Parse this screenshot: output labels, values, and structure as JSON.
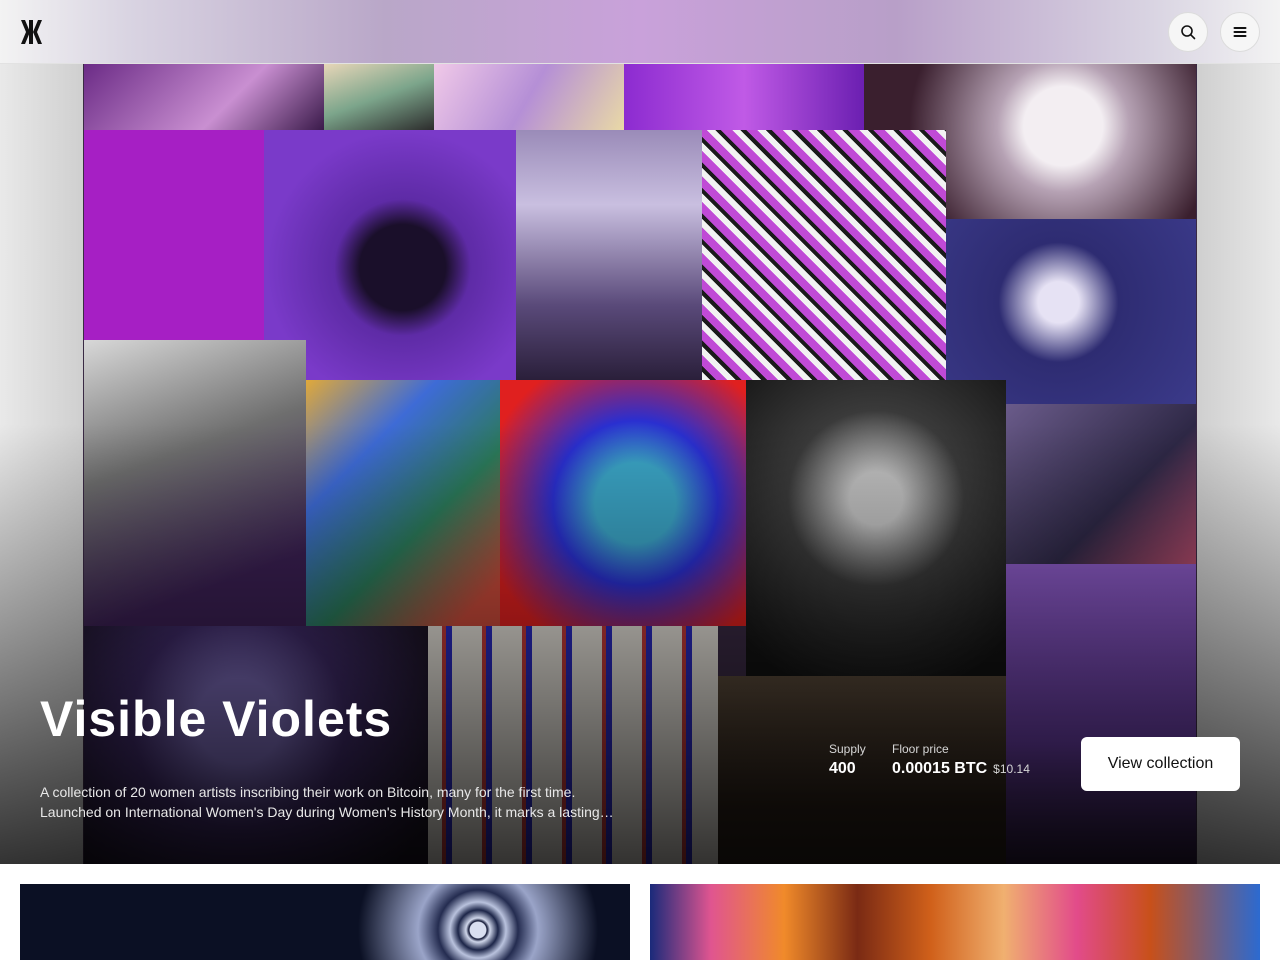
{
  "header": {
    "logo_icon": "magic-eden-logo-icon",
    "search_icon": "search-icon",
    "menu_icon": "hamburger-menu-icon"
  },
  "hero": {
    "title": "Visible Violets",
    "description_line1": "A collection of 20 women artists inscribing their work on Bitcoin, many for the first time.",
    "description_line2": "Launched on International Women's Day during Women's History Month, it marks a lasting…",
    "supply_label": "Supply",
    "supply_value": "400",
    "floor_label": "Floor price",
    "floor_value": "0.00015 BTC",
    "floor_usd": "$10.14",
    "cta_label": "View collection"
  },
  "colors": {
    "accent_purple": "#8a2be2",
    "hero_text": "#ffffff",
    "button_bg": "#ffffff"
  }
}
